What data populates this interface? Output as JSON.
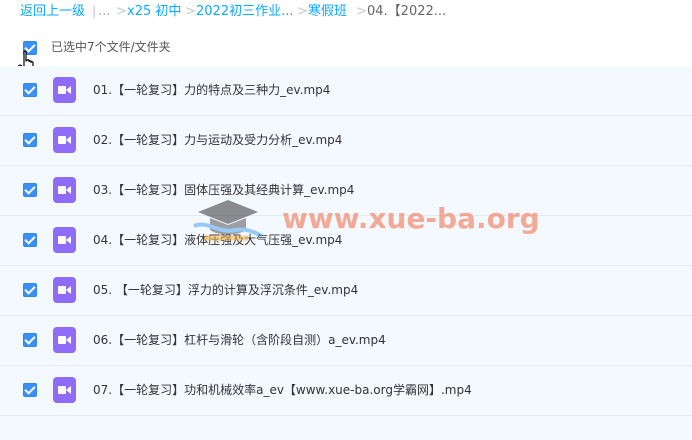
{
  "breadcrumb": {
    "back": "返回上一级",
    "sep": "|",
    "ellipsis": "...",
    "arrow": ">",
    "item1": "x25 初中",
    "item2": "2022初三作业...",
    "item3": "寒假班",
    "current": "04.【2022..."
  },
  "selection": {
    "label": "已选中7个文件/文件夹"
  },
  "files": [
    {
      "name": "01.【一轮复习】力的特点及三种力_ev.mp4"
    },
    {
      "name": "02.【一轮复习】力与运动及受力分析_ev.mp4"
    },
    {
      "name": "03.【一轮复习】固体压强及其经典计算_ev.mp4"
    },
    {
      "name": "04.【一轮复习】液体压强及大气压强_ev.mp4"
    },
    {
      "name": "05. 【一轮复习】浮力的计算及浮沉条件_ev.mp4"
    },
    {
      "name": "06.【一轮复习】杠杆与滑轮（含阶段自测）a_ev.mp4"
    },
    {
      "name": "07.【一轮复习】功和机械效率a_ev【www.xue-ba.org学霸网】.mp4"
    }
  ],
  "watermark": {
    "text": "www.xue-ba.org"
  },
  "colors": {
    "link": "#09aaff",
    "checkbox": "#3b8ff6",
    "video_icon": "#8f6cf7",
    "list_bg": "#f4f8ff"
  },
  "icons": {
    "file_type": "video-file-icon",
    "cursor": "hand-pointer-cursor"
  }
}
